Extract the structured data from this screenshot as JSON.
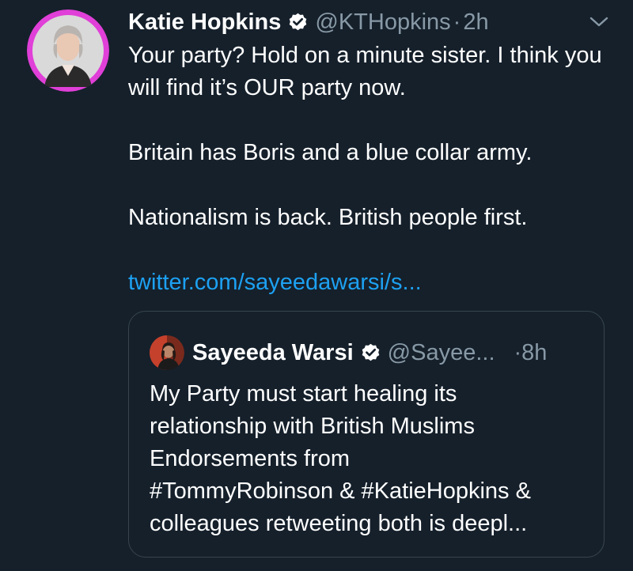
{
  "tweet": {
    "author_name": "Katie Hopkins",
    "handle": "@KTHopkins",
    "separator": "·",
    "time": "2h",
    "paragraphs": [
      "Your party? Hold on a minute sister. I think you will find it’s OUR party now.",
      "Britain has Boris and a blue collar army.",
      "Nationalism is back. British people first."
    ],
    "link": "twitter.com/sayeedawarsi/s..."
  },
  "quoted_tweet": {
    "author_name": "Sayeeda Warsi",
    "handle": "@Sayee...",
    "time": "·8h",
    "lines": [
      "My Party must start healing its",
      "relationship with British Muslims",
      "Endorsements from",
      "#TommyRobinson & #KatieHopkins &",
      "colleagues retweeting both is deepl..."
    ]
  },
  "icons": {
    "verified": "verified-badge-icon",
    "menu": "chevron-down-icon"
  },
  "colors": {
    "background": "#15202b",
    "link": "#1da1f2",
    "secondary_text": "#8899a6",
    "border": "#38444d",
    "avatar_ring": "#e03fd8"
  }
}
